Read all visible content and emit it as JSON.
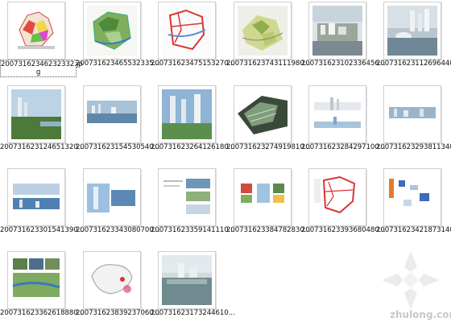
{
  "files": [
    {
      "name": "20073162346232332.jp",
      "name_line2": "g",
      "selected": true
    },
    {
      "name": "200731623465532335..."
    },
    {
      "name": "200731623475153270..."
    },
    {
      "name": "200731623743111980..."
    },
    {
      "name": "200731623102336456..."
    },
    {
      "name": "200731623112696440..."
    },
    {
      "name": "200731623124651320..."
    },
    {
      "name": "200731623154530540..."
    },
    {
      "name": "200731623264126180..."
    },
    {
      "name": "200731623274919810..."
    },
    {
      "name": "200731623284297100..."
    },
    {
      "name": "200731623293811340..."
    },
    {
      "name": "200731623301541390..."
    },
    {
      "name": "200731623343080700..."
    },
    {
      "name": "200731623359141110..."
    },
    {
      "name": "200731623384782830..."
    },
    {
      "name": "200731623393680480..."
    },
    {
      "name": "200731623421873140..."
    },
    {
      "name": "200731623362618880..."
    },
    {
      "name": "200731623839237060..."
    },
    {
      "name": "200731623173244610..."
    }
  ],
  "watermark": {
    "text": "zhulong.com"
  }
}
